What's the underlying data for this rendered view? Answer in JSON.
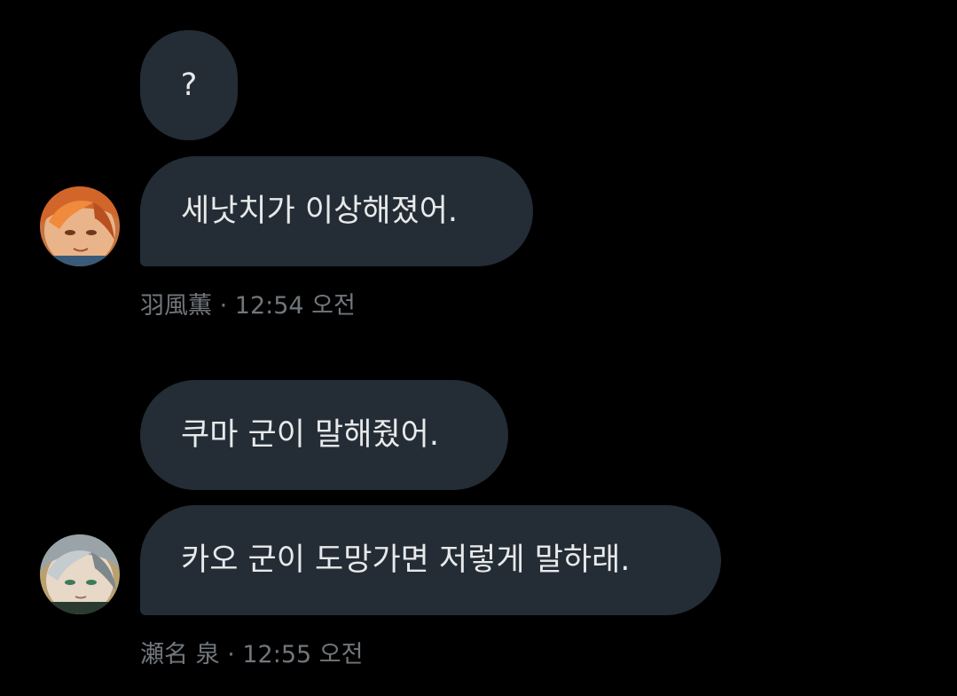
{
  "conversation": {
    "groups": [
      {
        "messages": [
          {
            "text": "?"
          },
          {
            "text": "세낫치가 이상해졌어."
          }
        ],
        "sender": "羽風薫",
        "separator": "·",
        "time": "12:54 오전"
      },
      {
        "messages": [
          {
            "text": "쿠마 군이 말해줬어."
          },
          {
            "text": "카오 군이 도망가면 저렇게 말하래."
          }
        ],
        "sender": "瀬名 泉",
        "separator": "·",
        "time": "12:55 오전"
      }
    ]
  },
  "colors": {
    "background": "#000000",
    "bubble": "#242d35",
    "text": "#e7e9ea",
    "meta": "#71767b"
  },
  "icons": {
    "avatar_1": "orange-haired-character-avatar",
    "avatar_2": "silver-haired-character-avatar"
  }
}
